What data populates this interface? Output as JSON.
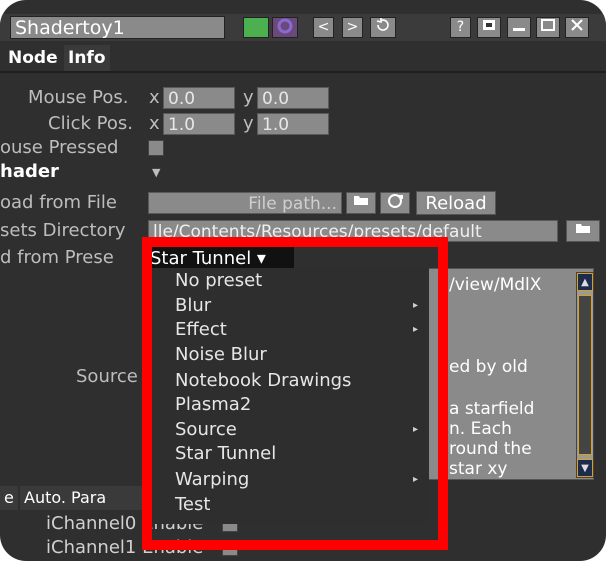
{
  "window": {
    "title": "Shadertoy1",
    "buttons": [
      "<",
      ">",
      "?"
    ]
  },
  "tabs": [
    {
      "label": "Node"
    },
    {
      "label": "Info"
    }
  ],
  "params": {
    "mouse_pos": {
      "label": "Mouse Pos.",
      "x_label": "x",
      "x_value": "0.0",
      "y_label": "y",
      "y_value": "0.0"
    },
    "click_pos": {
      "label": "Click Pos.",
      "x_label": "x",
      "x_value": "1.0",
      "y_label": "y",
      "y_value": "1.0"
    },
    "mouse_pressed": {
      "label": "ouse Pressed"
    },
    "shader": {
      "label": "hader",
      "arrow": "▼"
    },
    "load_from_file": {
      "label": "oad from File",
      "placeholder": "File path...",
      "reload_label": "Reload"
    },
    "presets_directory": {
      "label": "sets Directory",
      "value": "lle/Contents/Resources/presets/default"
    },
    "load_from_preset": {
      "label": "d from Prese",
      "selected": "Star Tunnel ▾"
    },
    "source": {
      "label": "Source",
      "visible_lines": [
        "/view/MdlX",
        "ed by old",
        "a starfield",
        "n. Each",
        "round the",
        "star xy"
      ]
    },
    "auto_params": {
      "label": "Auto. Para"
    },
    "ichannel0": {
      "label": "iChannel0 Enable"
    },
    "ichannel1": {
      "label": "iChannel1 Enable"
    }
  },
  "bottom_tabs": [
    {
      "label": "e"
    }
  ],
  "preset_menu": {
    "items": [
      {
        "label": "No preset",
        "submenu": false
      },
      {
        "label": "Blur",
        "submenu": true
      },
      {
        "label": "Effect",
        "submenu": true
      },
      {
        "label": "Noise Blur",
        "submenu": false
      },
      {
        "label": "Notebook Drawings",
        "submenu": false
      },
      {
        "label": "Plasma2",
        "submenu": false
      },
      {
        "label": "Source",
        "submenu": true
      },
      {
        "label": "Star Tunnel",
        "submenu": false
      },
      {
        "label": "Warping",
        "submenu": true
      },
      {
        "label": "Test",
        "submenu": false
      }
    ]
  },
  "colors": {
    "panel": "#2f2f2f",
    "field": "#8a8a8a",
    "highlight": "#ff0000",
    "accent_green": "#4caf50",
    "scroll_accent": "#d8a020"
  }
}
